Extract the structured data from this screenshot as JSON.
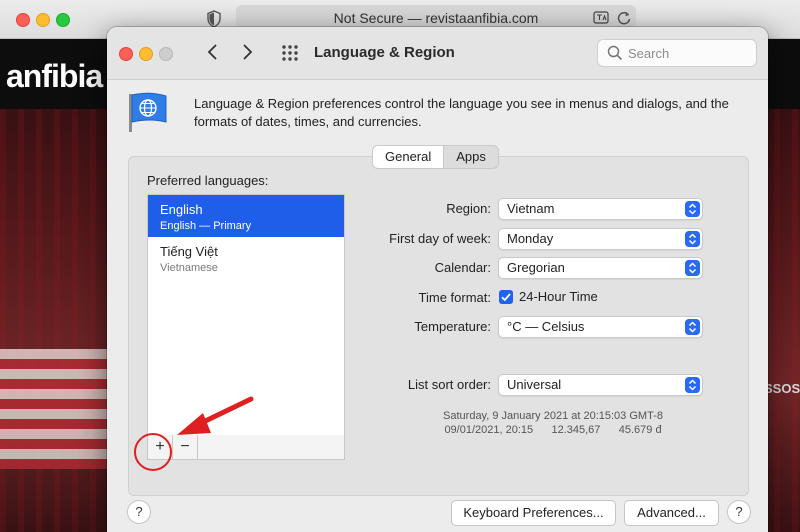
{
  "browser": {
    "url_text": "Not Secure — revistaanfibia.com"
  },
  "site": {
    "logo": "anfibia",
    "sticker": "SSOS"
  },
  "window": {
    "title": "Language & Region",
    "search_placeholder": "Search",
    "description": "Language & Region preferences control the language you see in menus and dialogs, and the formats of dates, times, and currencies."
  },
  "tabs": [
    {
      "label": "General",
      "active": true
    },
    {
      "label": "Apps",
      "active": false
    }
  ],
  "languages": {
    "label": "Preferred languages:",
    "items": [
      {
        "name": "English",
        "sub": "English — Primary",
        "selected": true
      },
      {
        "name": "Tiếng Việt",
        "sub": "Vietnamese",
        "selected": false
      }
    ],
    "add_label": "+",
    "remove_label": "−"
  },
  "settings": {
    "region_label": "Region:",
    "region_value": "Vietnam",
    "first_day_label": "First day of week:",
    "first_day_value": "Monday",
    "calendar_label": "Calendar:",
    "calendar_value": "Gregorian",
    "time_format_label": "Time format:",
    "time_format_option": "24-Hour Time",
    "time_format_checked": true,
    "temperature_label": "Temperature:",
    "temperature_value": "°C — Celsius",
    "sort_label": "List sort order:",
    "sort_value": "Universal"
  },
  "sample": {
    "line1": "Saturday, 9 January 2021 at 20:15:03 GMT-8",
    "line2": "09/01/2021, 20:15      12.345,67      45.679 đ"
  },
  "footer": {
    "help_label": "?",
    "keyboard_button": "Keyboard Preferences...",
    "advanced_button": "Advanced..."
  },
  "colors": {
    "accent": "#1f5ee8",
    "annotation": "#e02020"
  }
}
